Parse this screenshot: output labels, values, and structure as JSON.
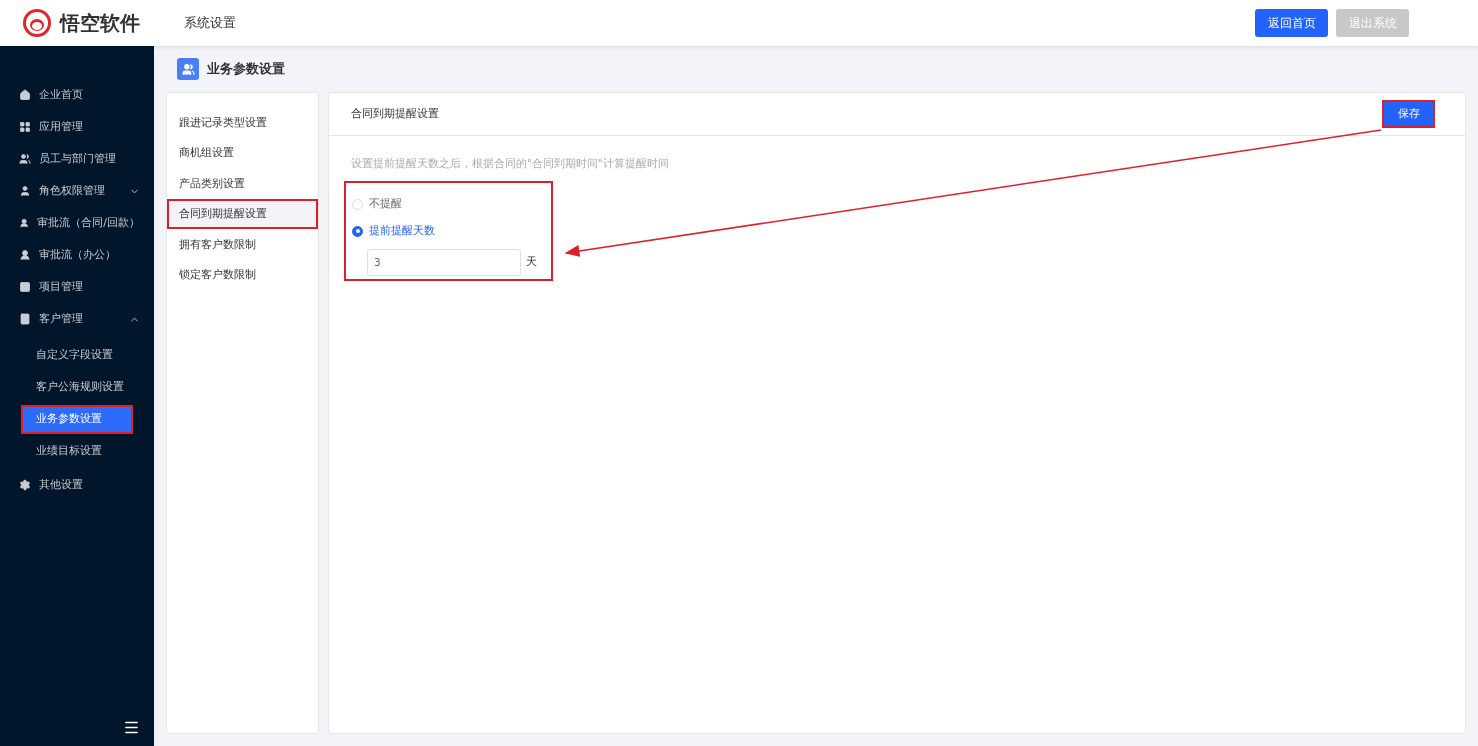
{
  "header": {
    "logo_text": "悟空软件",
    "section": "系统设置",
    "buttons": [
      {
        "label": "返回首页",
        "disabled": false
      },
      {
        "label": "退出系统",
        "disabled": true
      }
    ]
  },
  "sidebar": {
    "items": [
      {
        "label": "企业首页",
        "kind": "link"
      },
      {
        "label": "应用管理",
        "kind": "link"
      },
      {
        "label": "员工与部门管理",
        "kind": "link"
      },
      {
        "label": "角色权限管理",
        "kind": "group",
        "expanded": false
      },
      {
        "label": "审批流（合同/回款）",
        "kind": "link"
      },
      {
        "label": "审批流（办公）",
        "kind": "link"
      },
      {
        "label": "项目管理",
        "kind": "link"
      },
      {
        "label": "客户管理",
        "kind": "group",
        "expanded": true,
        "children": [
          {
            "label": "自定义字段设置",
            "selected": false,
            "annotated": false
          },
          {
            "label": "客户公海规则设置",
            "selected": false,
            "annotated": false
          },
          {
            "label": "业务参数设置",
            "selected": true,
            "annotated": true
          },
          {
            "label": "业绩目标设置",
            "selected": false,
            "annotated": false
          }
        ]
      },
      {
        "label": "其他设置",
        "kind": "link"
      }
    ]
  },
  "page_title": "业务参数设置",
  "submenu": [
    {
      "label": "跟进记录类型设置",
      "selected": false,
      "annotated": false
    },
    {
      "label": "商机组设置",
      "selected": false,
      "annotated": false
    },
    {
      "label": "产品类别设置",
      "selected": false,
      "annotated": false
    },
    {
      "label": "合同到期提醒设置",
      "selected": true,
      "annotated": true
    },
    {
      "label": "拥有客户数限制",
      "selected": false,
      "annotated": false
    },
    {
      "label": "锁定客户数限制",
      "selected": false,
      "annotated": false
    }
  ],
  "panel": {
    "title": "合同到期提醒设置",
    "save_button": {
      "label": "保存",
      "annotated": true
    },
    "hint": "设置提前提醒天数之后，根据合同的\"合同到期时间\"计算提醒时间",
    "options_annotated": true,
    "options": [
      {
        "label": "不提醒",
        "selected": false
      },
      {
        "label": "提前提醒天数",
        "selected": true
      }
    ],
    "days": {
      "value": "3",
      "unit": "天"
    }
  }
}
